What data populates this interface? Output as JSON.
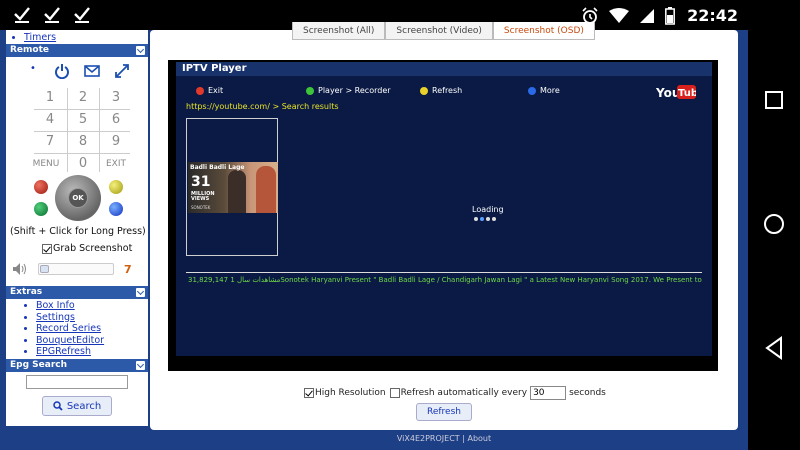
{
  "status_bar": {
    "time": "22:42"
  },
  "sidebar": {
    "timers_link": "Timers",
    "remote_title": "Remote",
    "keypad": [
      "1",
      "2",
      "3",
      "4",
      "5",
      "6",
      "7",
      "8",
      "9",
      "MENU",
      "0",
      "EXIT"
    ],
    "ok_label": "OK",
    "hint": "(Shift + Click for Long Press)",
    "grab_label": "Grab Screenshot",
    "volume_value": "7",
    "extras_title": "Extras",
    "extras_links": [
      "Box Info",
      "Settings",
      "Record Series",
      "BouquetEditor",
      "EPGRefresh"
    ],
    "epg_title": "Epg Search",
    "search_label": "Search"
  },
  "main": {
    "tabs": [
      "Screenshot (All)",
      "Screenshot (Video)",
      "Screenshot (OSD)"
    ],
    "player_title": "IPTV Player",
    "buttons": [
      {
        "label": "Exit",
        "color": "#e23a2a"
      },
      {
        "label": "Player > Recorder",
        "color": "#3ec43a"
      },
      {
        "label": "Refresh",
        "color": "#e8d22a"
      },
      {
        "label": "More",
        "color": "#2a6ae8"
      }
    ],
    "breadcrumb": "https://youtube.com/ > Search results",
    "thumbnail": {
      "title": "Badli Badli Lage",
      "count": "31",
      "million": "MILLION",
      "views": "VIEWS",
      "brand": "SONOTEK"
    },
    "loading": "Loading",
    "ticker": "Sonotek Haryanvi Present \" Badli Badli Lage / Chandigarh Jawan Lagi \" a Latest New Haryanvi Song 2017. We Present to you \"",
    "ticker_views": "31,829,147 مشاهدات",
    "ticker_left": "سال 1",
    "high_res_label": "High Resolution",
    "auto_refresh_label": "Refresh automatically every",
    "refresh_value": "30",
    "seconds_label": "seconds",
    "refresh_button": "Refresh"
  },
  "footer": {
    "project": "ViX4E2PROJECT",
    "sep": "|",
    "about": "About"
  }
}
